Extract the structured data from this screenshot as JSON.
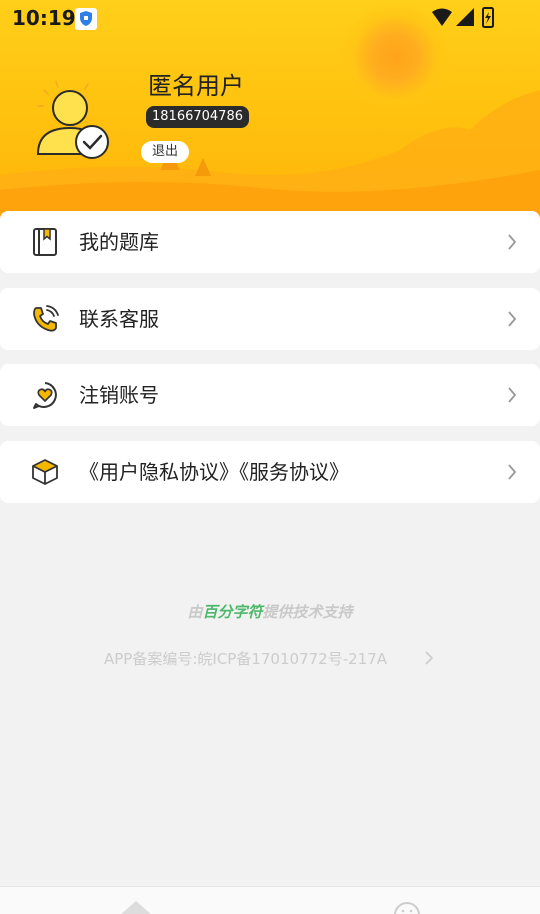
{
  "status_bar": {
    "time": "10:19"
  },
  "profile": {
    "username": "匿名用户",
    "phone": "18166704786",
    "logout_label": "退出"
  },
  "menu": {
    "items": [
      {
        "label": "我的题库",
        "icon": "book-icon"
      },
      {
        "label": "联系客服",
        "icon": "phone-icon"
      },
      {
        "label": "注销账号",
        "icon": "heart-chat-icon"
      },
      {
        "label": "《用户隐私协议》《服务协议》",
        "icon": "box-icon"
      }
    ]
  },
  "footer": {
    "powered_prefix": "由",
    "powered_brand": "百分字符",
    "powered_suffix": "提供技术支持",
    "icp": "APP备案编号:皖ICP备17010772号-217A"
  },
  "colors": {
    "header_yellow": "#ffc30f",
    "accent_orange": "#ffa31a",
    "brand_green": "#4cb86a"
  }
}
